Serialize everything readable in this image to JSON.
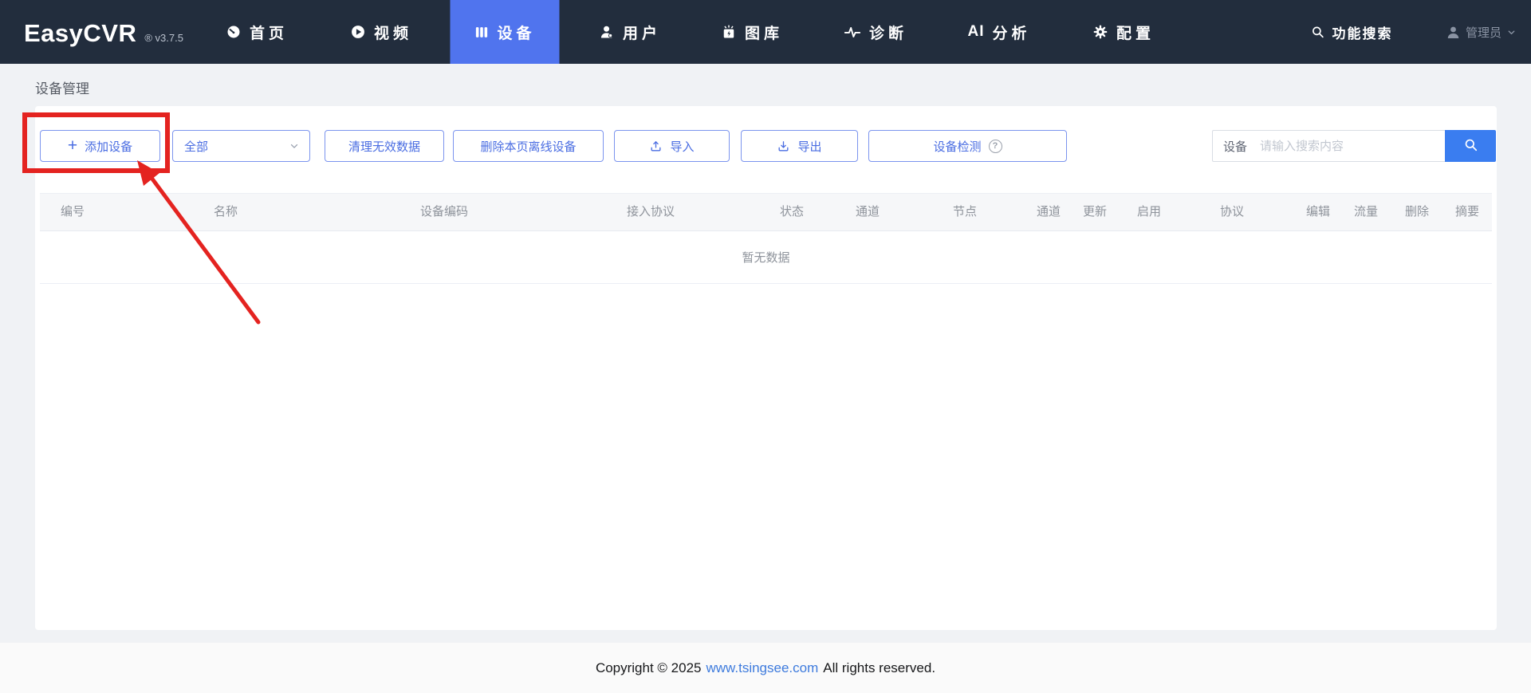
{
  "nav": {
    "logo": "EasyCVR",
    "version": "® v3.7.5",
    "items": [
      {
        "label": "首页",
        "icon": "dashboard-icon"
      },
      {
        "label": "视频",
        "icon": "play-icon"
      },
      {
        "label": "设备",
        "icon": "device-icon",
        "active": true
      },
      {
        "label": "用户",
        "icon": "user-icon"
      },
      {
        "label": "图库",
        "icon": "gallery-icon"
      },
      {
        "label": "诊断",
        "icon": "diagnosis-icon"
      },
      {
        "label": "分析",
        "icon": "ai-icon",
        "icon_text": "AI"
      },
      {
        "label": "配置",
        "icon": "gear-icon"
      }
    ],
    "search_label": "功能搜索",
    "account_label": "管理员"
  },
  "page": {
    "title": "设备管理"
  },
  "toolbar": {
    "add_button": "添加设备",
    "filter_select_value": "全部",
    "clean_button": "清理无效数据",
    "delete_offline_button": "删除本页离线设备",
    "import_button": "导入",
    "export_button": "导出",
    "detect_button": "设备检测",
    "detect_help": "?",
    "search_field_label": "设备",
    "search_placeholder": "请输入搜索内容"
  },
  "table": {
    "headers": [
      "编号",
      "名称",
      "设备编码",
      "接入协议",
      "状态",
      "通道",
      "节点",
      "通道",
      "更新",
      "启用",
      "协议",
      "编辑",
      "流量",
      "删除",
      "摘要"
    ],
    "empty_text": "暂无数据"
  },
  "footer": {
    "copyright_prefix": "Copyright © 2025",
    "link": "www.tsingsee.com",
    "copyright_suffix": "All rights reserved."
  },
  "colors": {
    "nav_bg": "#222d3d",
    "active_tab_blue": "#5074ee",
    "button_blue": "#4a6de2",
    "search_button_blue": "#3a7df0",
    "annotation_red": "#e42320",
    "link_blue": "#3e7bdd"
  }
}
